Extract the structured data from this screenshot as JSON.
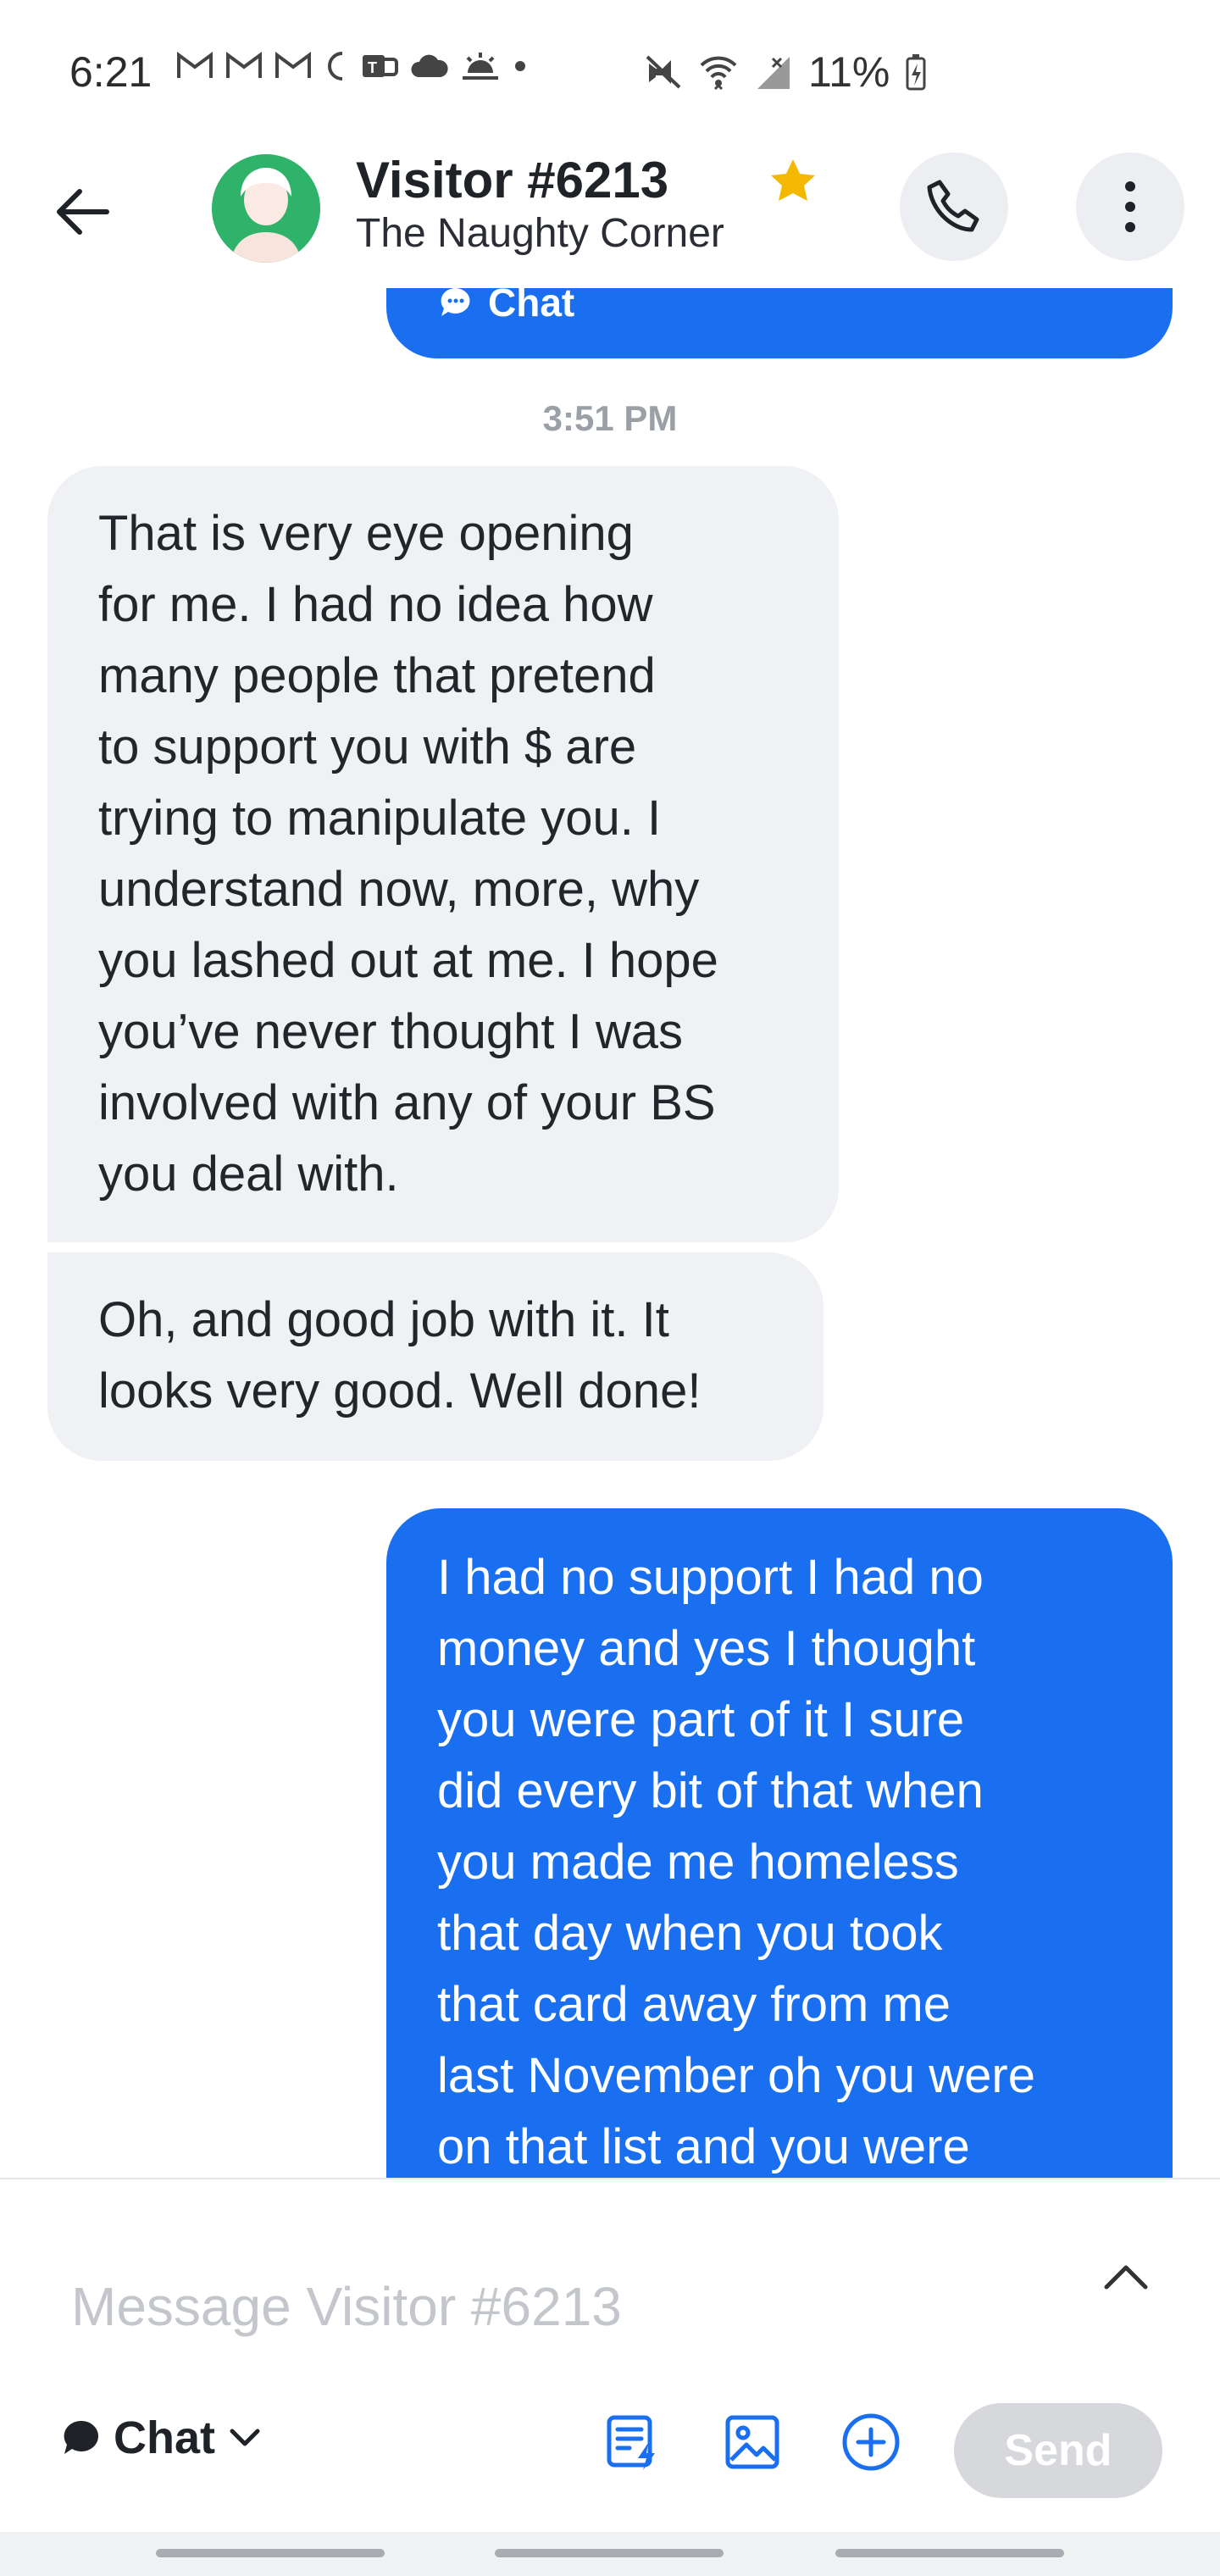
{
  "status_bar": {
    "time": "6:21",
    "battery": "11%",
    "left_icons": [
      "gmail-icon",
      "gmail-icon",
      "gmail-icon",
      "moon-icon",
      "teams-icon",
      "cloud-icon",
      "sunrise-icon",
      "dot-icon"
    ],
    "right_icons": [
      "vibrate-icon",
      "wifi-icon",
      "signal-icon",
      "battery-charging-icon"
    ]
  },
  "header": {
    "title": "Visitor #6213",
    "subtitle": "The Naughty Corner",
    "starred": true
  },
  "chat": {
    "top_bubble_label": "Chat",
    "timestamp": "3:51 PM",
    "messages": [
      {
        "direction": "incoming",
        "lines": [
          "That is very eye opening",
          "for me. I had no idea how",
          "many people that pretend",
          "to support you with $ are",
          "trying to manipulate you. I",
          "understand now, more, why",
          "you lashed out at me. I hope",
          "you’ve never thought I was",
          "involved with any of your BS",
          "you deal with."
        ]
      },
      {
        "direction": "incoming",
        "lines": [
          "Oh, and good job with it. It",
          "looks very good.  Well done!"
        ]
      },
      {
        "direction": "outgoing",
        "lines": [
          "I had no support I had no",
          "money and yes I thought",
          "you were part of it I sure",
          "did every bit of that when",
          "you made me homeless",
          "that day when you took",
          "that card away from me",
          "last November oh you were",
          "on that list and you were"
        ]
      }
    ]
  },
  "composer": {
    "placeholder": "Message Visitor #6213",
    "value": "",
    "mode_label": "Chat",
    "send_label": "Send"
  },
  "colors": {
    "accent": "#1a6ff0",
    "incoming_bubble": "#f0f1f4",
    "star": "#f5b800",
    "avatar_bg": "#2fb36b"
  }
}
